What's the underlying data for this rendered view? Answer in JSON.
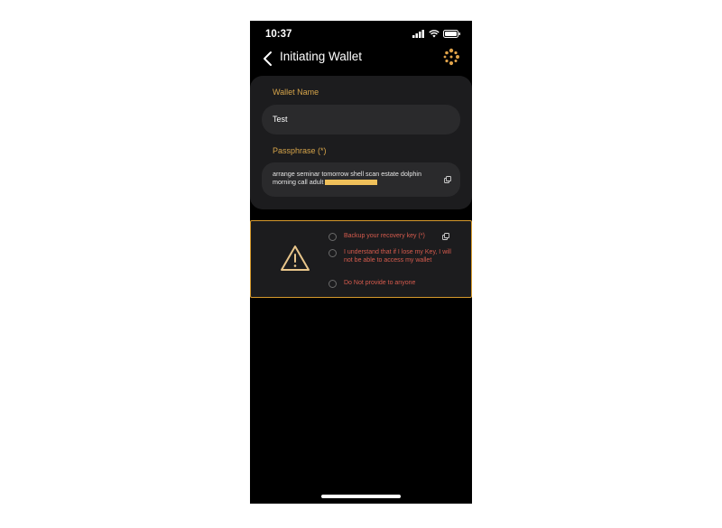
{
  "status_bar": {
    "time": "10:37"
  },
  "header": {
    "title": "Initiating Wallet"
  },
  "form": {
    "wallet_name_label": "Wallet Name",
    "wallet_name_value": "Test",
    "passphrase_label": "Passphrase (*)",
    "passphrase_value": "arrange seminar tomorrow shell scan estate dolphin morning call adult"
  },
  "warning": {
    "items": [
      {
        "label": "Backup your recovery key (*)"
      },
      {
        "label": "I understand that if I lose my Key, I will not be able to access my wallet"
      },
      {
        "label": "Do Not provide to anyone"
      }
    ]
  },
  "colors": {
    "accent": "#d6a44a",
    "warning_text": "#d65b4d",
    "warning_border": "#d69a2d",
    "card_bg": "#1c1c1e",
    "field_bg": "#2a2a2c"
  },
  "icons": [
    "back-chevron-icon",
    "cellular-signal-icon",
    "wifi-icon",
    "battery-icon",
    "app-logo-icon",
    "copy-icon",
    "warning-triangle-icon",
    "check-circle-icon"
  ]
}
